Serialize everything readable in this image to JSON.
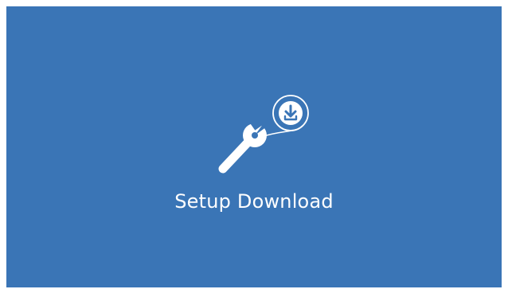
{
  "tile": {
    "label": "Setup Download",
    "icon": "wrench-download-icon",
    "background": "#3a75b6",
    "foreground": "#ffffff"
  }
}
